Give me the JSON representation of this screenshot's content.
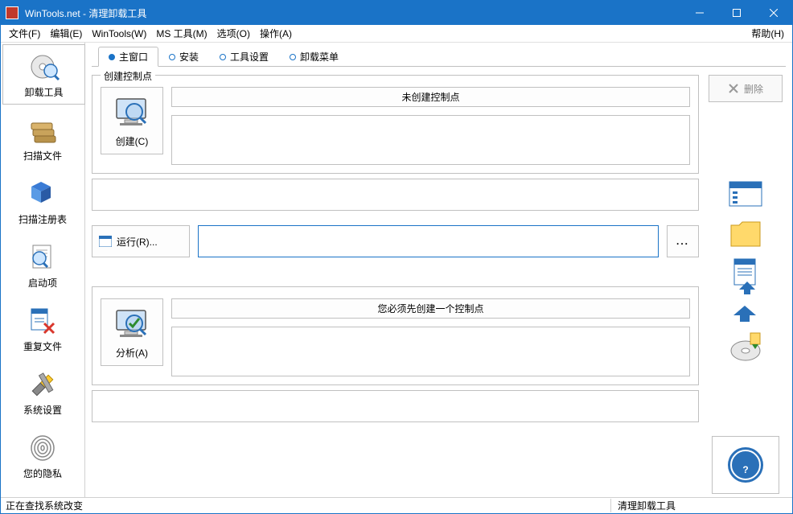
{
  "window": {
    "title": "WinTools.net - 清理卸载工具",
    "min_tooltip": "最小化",
    "max_tooltip": "最大化",
    "close_tooltip": "关闭"
  },
  "menu": {
    "file": "文件(F)",
    "edit": "编辑(E)",
    "wintools": "WinTools(W)",
    "mstools": "MS 工具(M)",
    "options": "选项(O)",
    "operations": "操作(A)",
    "help": "帮助(H)"
  },
  "sidebar": {
    "items": [
      {
        "label": "卸载工具",
        "icon": "disc-magnify"
      },
      {
        "label": "扫描文件",
        "icon": "files-stack"
      },
      {
        "label": "扫描注册表",
        "icon": "cubes"
      },
      {
        "label": "启动项",
        "icon": "doc-magnify"
      },
      {
        "label": "重复文件",
        "icon": "doc-x"
      },
      {
        "label": "系统设置",
        "icon": "wrench"
      },
      {
        "label": "您的隐私",
        "icon": "fingerprint"
      }
    ]
  },
  "tabs": {
    "items": [
      {
        "label": "主窗口"
      },
      {
        "label": "安装"
      },
      {
        "label": "工具设置"
      },
      {
        "label": "卸载菜单"
      }
    ]
  },
  "actions": {
    "delete": "删除",
    "browse": "...",
    "help": "?"
  },
  "section_create": {
    "group_label": "创建控制点",
    "button": "创建(C)",
    "header": "未创建控制点"
  },
  "section_run": {
    "button": "运行(R)...",
    "value": ""
  },
  "section_analyze": {
    "button": "分析(A)",
    "header": "您必须先创建一个控制点"
  },
  "status": {
    "left": "正在查找系统改变",
    "right": "清理卸载工具"
  }
}
